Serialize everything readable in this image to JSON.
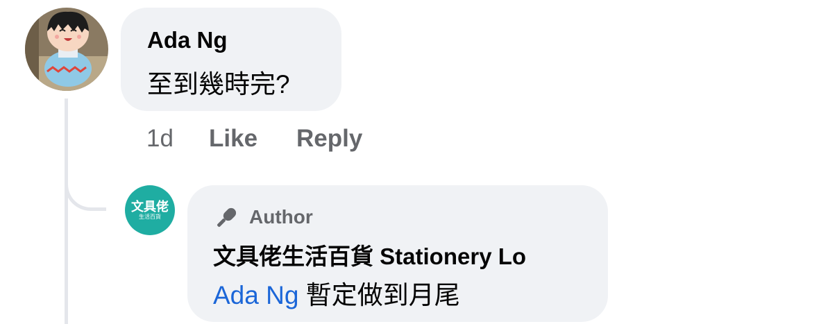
{
  "comment": {
    "author": "Ada Ng",
    "text": "至到幾時完?",
    "actions": {
      "time": "1d",
      "like": "Like",
      "reply": "Reply"
    }
  },
  "reply": {
    "avatar_logo": "文具佬",
    "avatar_logo_sub": "生活百貨",
    "badge_icon": "microphone-icon",
    "badge_label": "Author",
    "page_name": "文具佬生活百貨 Stationery Lo",
    "mention": "Ada Ng",
    "text": "暫定做到月尾"
  },
  "colors": {
    "bubble_bg": "#f0f2f5",
    "secondary_text": "#65676b",
    "mention_link": "#1b66d8",
    "page_avatar_bg": "#1fada2",
    "thread_line": "#e4e6eb"
  }
}
